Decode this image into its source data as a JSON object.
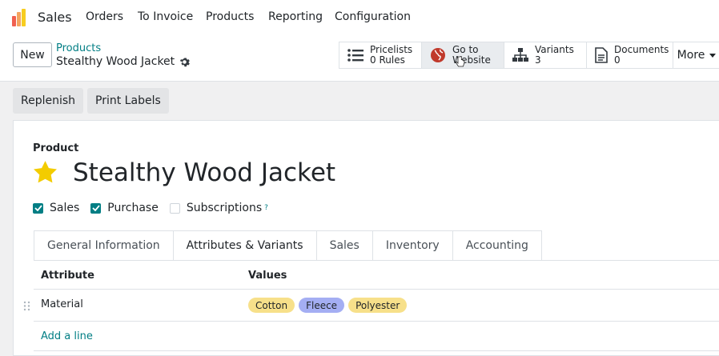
{
  "nav": {
    "app_name": "Sales",
    "items": [
      "Orders",
      "To Invoice",
      "Products",
      "Reporting",
      "Configuration"
    ]
  },
  "control": {
    "new_label": "New",
    "breadcrumb_parent": "Products",
    "breadcrumb_current": "Stealthy Wood Jacket",
    "stats": [
      {
        "label": "Pricelists",
        "value": "0 Rules",
        "icon": "list-icon"
      },
      {
        "label": "Go to",
        "value": "Website",
        "icon": "globe-icon"
      },
      {
        "label": "Variants",
        "value": "3",
        "icon": "sitemap-icon"
      },
      {
        "label": "Documents",
        "value": "0",
        "icon": "file-icon"
      }
    ],
    "more_label": "More"
  },
  "actions": [
    "Replenish",
    "Print Labels"
  ],
  "product": {
    "section_label": "Product",
    "name": "Stealthy Wood Jacket",
    "favorite": true,
    "checkboxes": [
      {
        "label": "Sales",
        "checked": true
      },
      {
        "label": "Purchase",
        "checked": true
      },
      {
        "label": "Subscriptions",
        "checked": false,
        "help": "?"
      }
    ]
  },
  "tabs": [
    "General Information",
    "Attributes & Variants",
    "Sales",
    "Inventory",
    "Accounting"
  ],
  "active_tab": "Attributes & Variants",
  "table": {
    "headers": [
      "Attribute",
      "Values"
    ],
    "rows": [
      {
        "attribute": "Material",
        "values": [
          "Cotton",
          "Fleece",
          "Polyester"
        ]
      }
    ],
    "add_line": "Add a line"
  },
  "colors": {
    "accent": "#017e84",
    "tag_cotton": "#f7e08a",
    "tag_fleece": "#a4aef3",
    "tag_polyester": "#f7e08a",
    "star": "#f3cc00"
  }
}
